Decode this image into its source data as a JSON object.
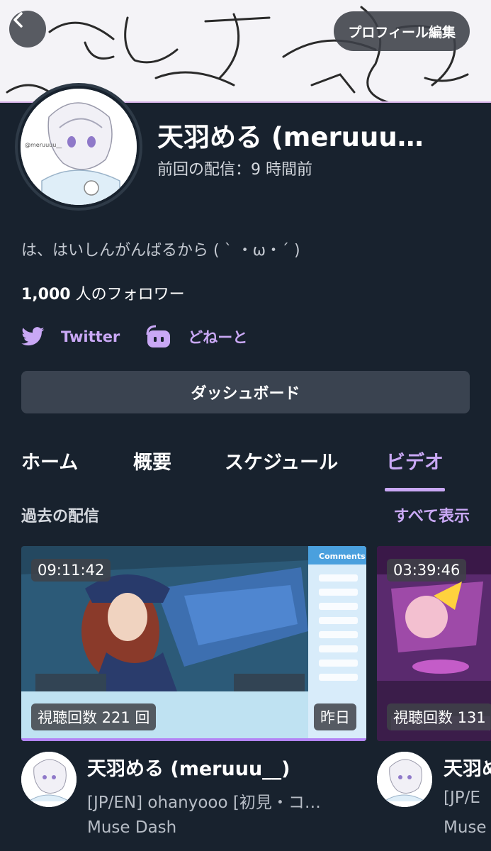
{
  "header": {
    "back_icon": "chevron-left-icon",
    "edit_profile_label": "プロフィール編集"
  },
  "profile": {
    "name": "天羽める (meruuu…",
    "last_stream": "前回の配信：9 時間前",
    "bio": "は、はいしんがんばるから ( ˋ ・ω・ˊ )",
    "followers_count": "1,000",
    "followers_suffix": " 人のフォロワー",
    "avatar_watermark": "@meruuuu__"
  },
  "links": [
    {
      "label": "Twitter",
      "icon": "twitter-bird-icon"
    },
    {
      "label": "どねーと",
      "icon": "donate-icon"
    }
  ],
  "dashboard_label": "ダッシュボード",
  "tabs": [
    {
      "label": "ホーム",
      "active": false
    },
    {
      "label": "概要",
      "active": false
    },
    {
      "label": "スケジュール",
      "active": false
    },
    {
      "label": "ビデオ",
      "active": true
    }
  ],
  "section": {
    "title": "過去の配信",
    "show_all": "すべて表示"
  },
  "videos": [
    {
      "duration": "09:11:42",
      "views": "視聴回数 221 回",
      "date": "昨日",
      "channel": "天羽める (meruuu__)",
      "title": "[JP/EN] ohanyooo [初見・コ…",
      "game": "Muse Dash",
      "overlay_comments": "Comments",
      "watched_fraction": 1.0
    },
    {
      "duration": "03:39:46",
      "views": "視聴回数 131",
      "channel": "天羽め",
      "title": "[JP/E",
      "game": "Muse"
    }
  ],
  "colors": {
    "background": "#18222e",
    "accent": "#c9a8f5",
    "button": "#3a4350"
  }
}
